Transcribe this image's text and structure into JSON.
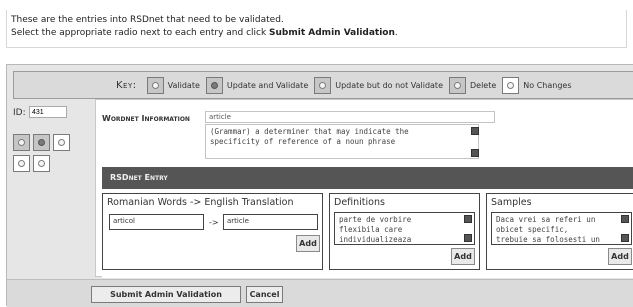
{
  "intro": {
    "line1": "These are the entries into RSDnet that need to be validated.",
    "line2_prefix": "Select the appropriate radio next to each entry and click ",
    "line2_bold": "Submit Admin Validation",
    "line2_suffix": "."
  },
  "key": {
    "label": "Key:",
    "items": [
      {
        "label": "Validate"
      },
      {
        "label": "Update and Validate"
      },
      {
        "label": "Update but do not Validate"
      },
      {
        "label": "Delete"
      },
      {
        "label": "No Changes"
      }
    ]
  },
  "entry": {
    "id_label": "ID:",
    "id_value": "431"
  },
  "wordnet": {
    "label": "Wordnet Information",
    "word": "article",
    "definition_line1": "(Grammar) a determiner that may indicate the",
    "definition_line2": "specificity of reference of a noun phrase"
  },
  "rsdnet": {
    "header": "RSDnet Entry",
    "translation": {
      "title": "Romanian Words -> English Translation",
      "romanian": "articol",
      "arrow": "->",
      "english": "article",
      "add_label": "Add"
    },
    "definitions": {
      "title": "Definitions",
      "line1": " parte de vorbire",
      "line2": "flexibila care",
      "line3": "individualizeaza",
      "add_label": "Add"
    },
    "samples": {
      "title": "Samples",
      "line1": "Daca vrei sa referi un",
      "line2": "obicet specific,",
      "line3": "trebuie sa folosesti un",
      "add_label": "Add"
    }
  },
  "footer": {
    "submit_label": "Submit Admin Validation",
    "cancel_label": "Cancel"
  }
}
